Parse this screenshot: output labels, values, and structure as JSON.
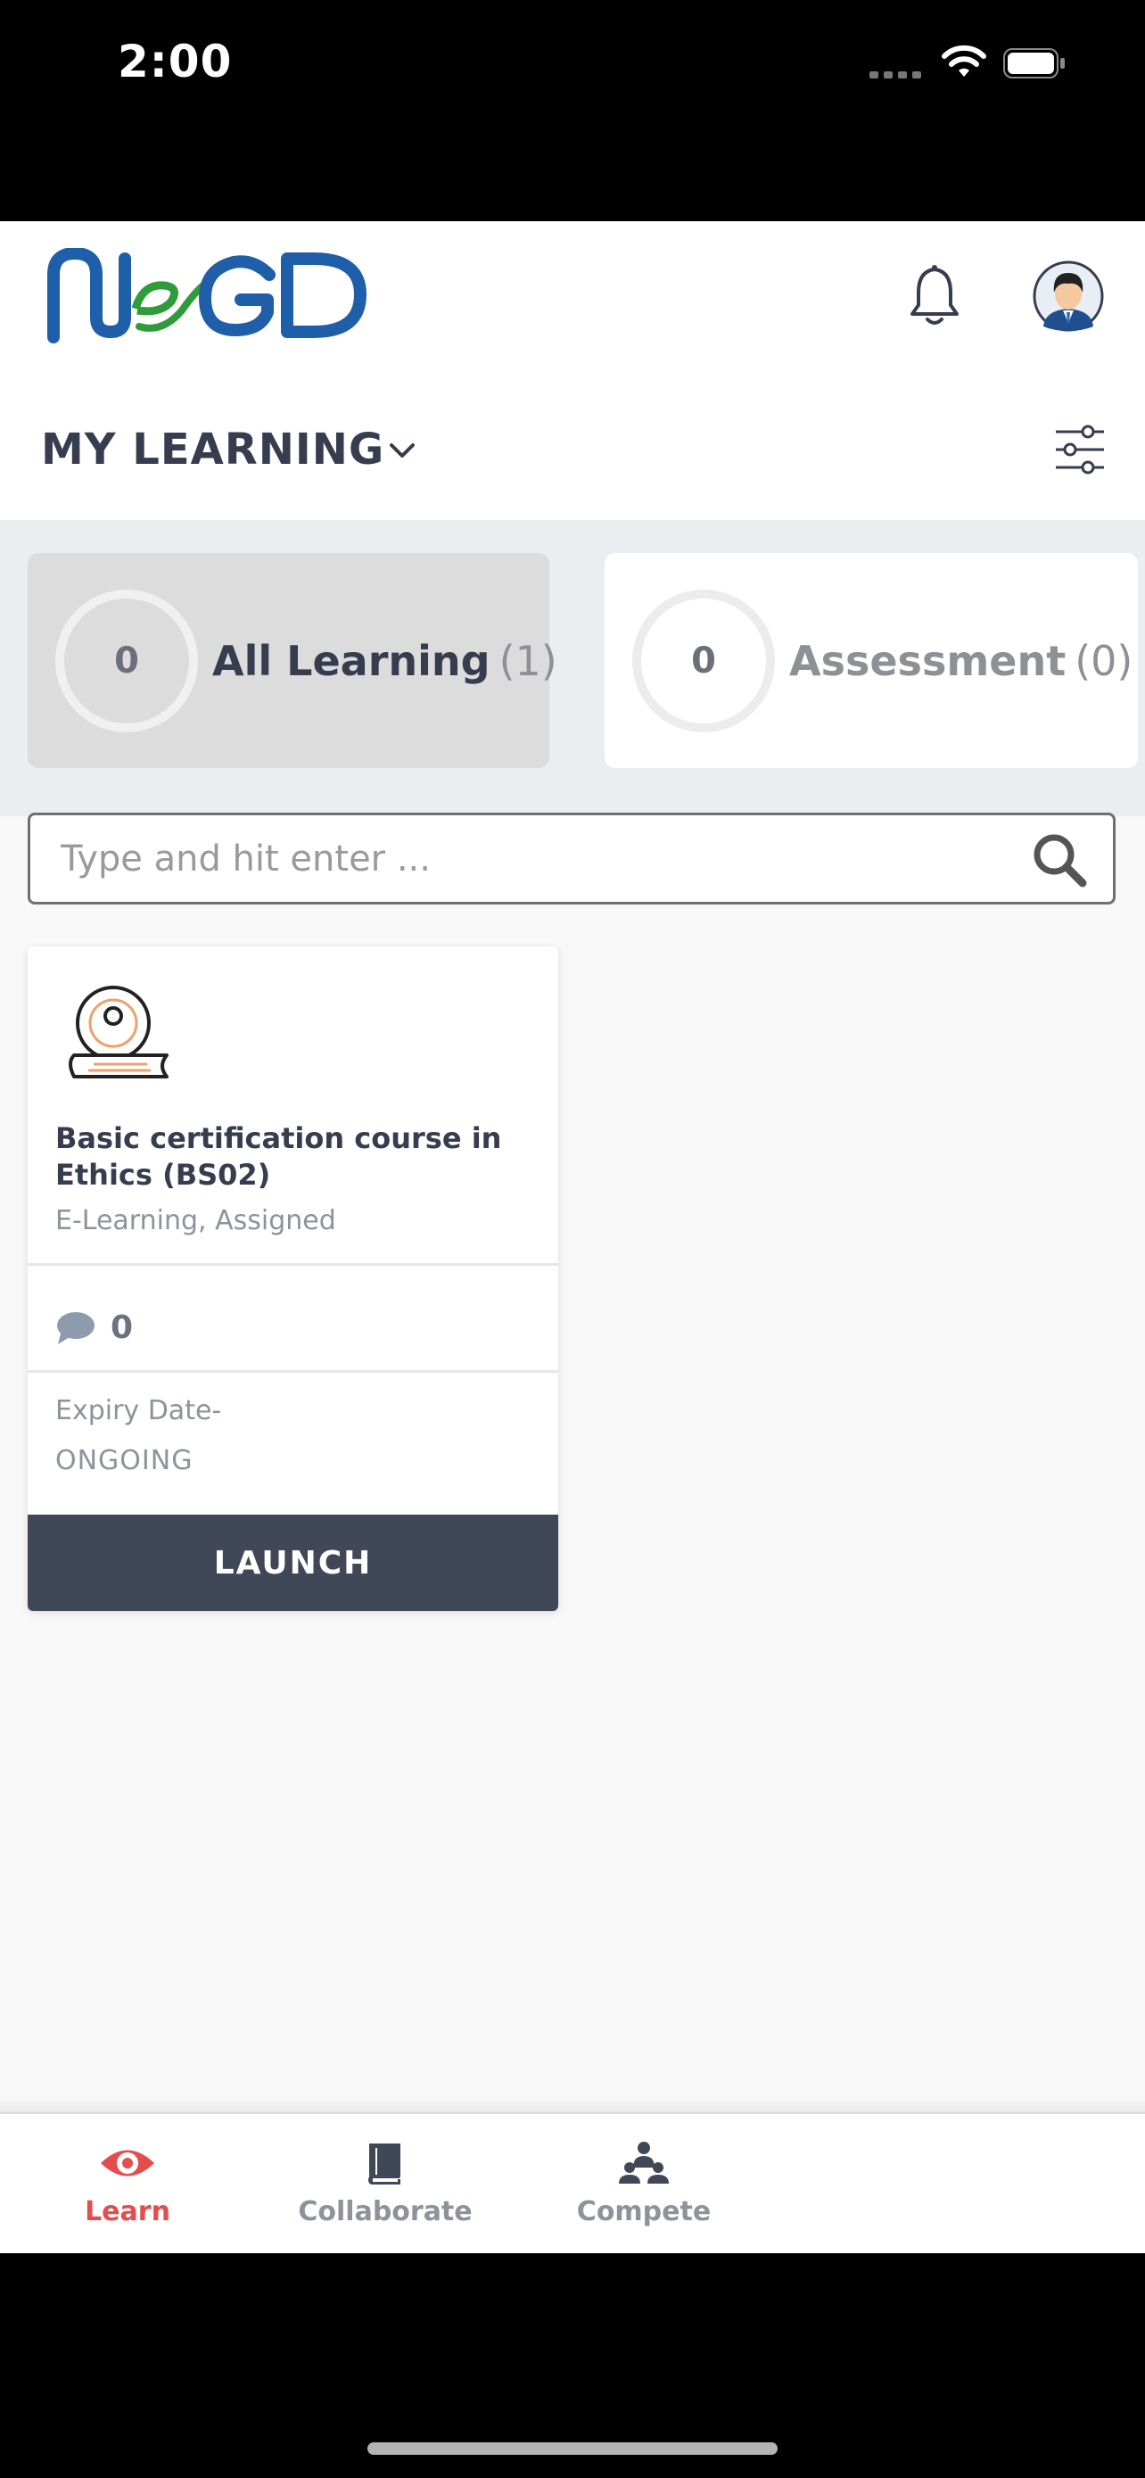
{
  "status_bar": {
    "time": "2:00"
  },
  "header": {
    "logo_text": "NeGD",
    "title": "MY LEARNING"
  },
  "tabs": [
    {
      "count": "0",
      "label": "All Learning",
      "total": "(1)",
      "active": true
    },
    {
      "count": "0",
      "label": "Assessment",
      "total": "(0)",
      "active": false
    }
  ],
  "search": {
    "placeholder": "Type and hit enter ..."
  },
  "course": {
    "title": "Basic certification course in Ethics (BS02)",
    "meta": "E-Learning, Assigned",
    "comments": "0",
    "expiry_label": "Expiry Date-",
    "expiry_value": "ONGOING",
    "launch_label": "LAUNCH"
  },
  "bottom_nav": [
    {
      "label": "Learn",
      "icon": "eye-icon",
      "active": true
    },
    {
      "label": "Collaborate",
      "icon": "book-icon",
      "active": false
    },
    {
      "label": "Compete",
      "icon": "group-icon",
      "active": false
    }
  ],
  "colors": {
    "accent": "#e54c4c",
    "dark": "#363d4f",
    "launch_bg": "#404757",
    "muted": "#8e929b"
  }
}
